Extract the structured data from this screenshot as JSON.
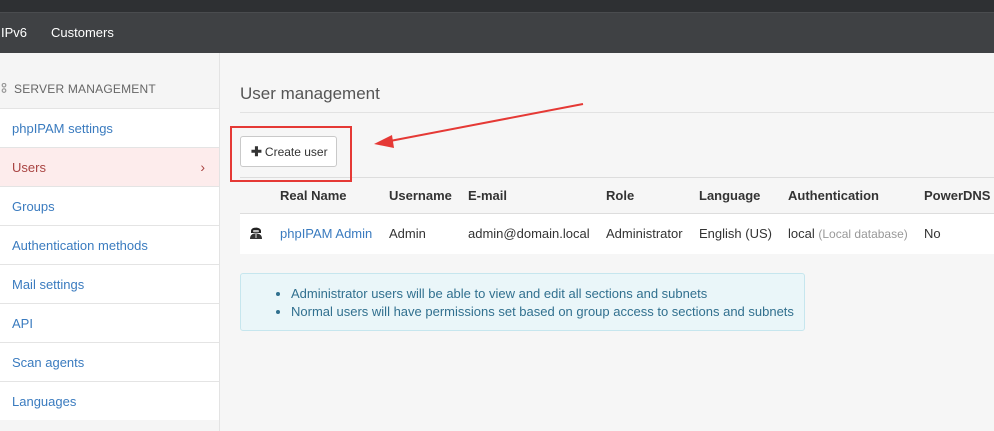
{
  "navbar": {
    "items": [
      "IPv6",
      "Customers"
    ]
  },
  "sidebar": {
    "header": "SERVER MANAGEMENT",
    "items": [
      {
        "label": "phpIPAM settings"
      },
      {
        "label": "Users",
        "active": true,
        "chevron": "›"
      },
      {
        "label": "Groups"
      },
      {
        "label": "Authentication methods"
      },
      {
        "label": "Mail settings"
      },
      {
        "label": "API"
      },
      {
        "label": "Scan agents"
      },
      {
        "label": "Languages"
      }
    ]
  },
  "main": {
    "title": "User management",
    "create_button": {
      "icon": "✚",
      "label": "Create user"
    },
    "table": {
      "headers": [
        "",
        "Real Name",
        "Username",
        "E-mail",
        "Role",
        "Language",
        "Authentication",
        "PowerDNS"
      ],
      "rows": [
        {
          "icon": "user-avatar-icon",
          "real_name": "phpIPAM Admin",
          "username": "Admin",
          "email": "admin@domain.local",
          "role": "Administrator",
          "language": "English (US)",
          "auth": "local",
          "auth_note": "(Local database)",
          "powerdns": "No"
        }
      ]
    },
    "info": [
      "Administrator users will be able to view and edit all sections and subnets",
      "Normal users will have permissions set based on group access to sections and subnets"
    ]
  },
  "annotation": {
    "color": "#e53935"
  }
}
